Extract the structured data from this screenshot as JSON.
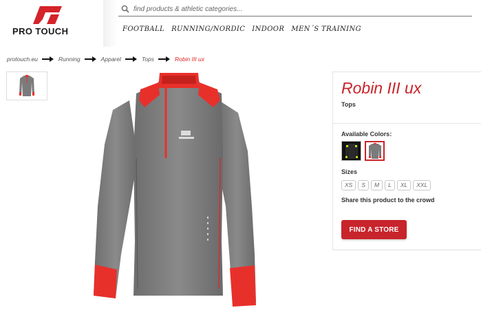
{
  "brand": {
    "name": "PRO TOUCH",
    "logo_icon": "pro-touch-logo",
    "logo_color": "#d5232a"
  },
  "search": {
    "placeholder": "find products & athletic categories...",
    "icon": "search-icon"
  },
  "nav": {
    "items": [
      "FOOTBALL",
      "RUNNING/NORDIC",
      "INDOOR",
      "MEN´S TRAINING"
    ]
  },
  "breadcrumb": {
    "items": [
      "protouch.eu",
      "Running",
      "Apparel",
      "Tops"
    ],
    "current": "Robin III ux"
  },
  "product": {
    "title": "Robin III ux",
    "category": "Tops",
    "colors_label": "Available Colors:",
    "sizes_label": "Sizes",
    "sizes": [
      "XS",
      "S",
      "M",
      "L",
      "XL",
      "XXL"
    ],
    "share_label": "Share this product to the crowd",
    "store_button": "FIND A STORE"
  },
  "colors": {
    "accent": "#c8242b",
    "shirt_body": "#7b7b7c",
    "shirt_trim": "#e8302b"
  }
}
